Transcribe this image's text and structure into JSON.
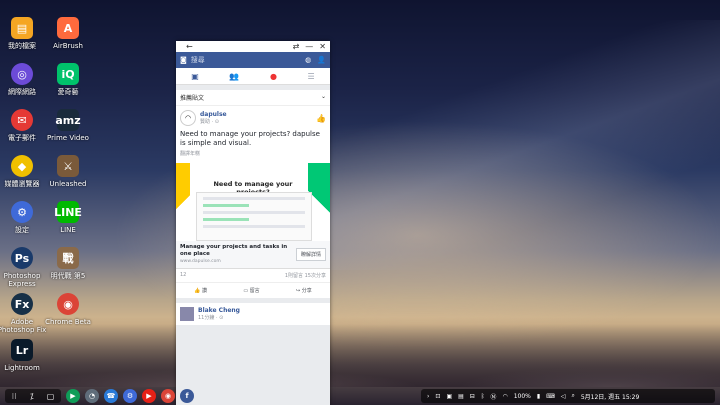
{
  "desktop_icons": [
    {
      "label": "我的檔案",
      "glyph": "▤",
      "color": "#f5a623",
      "shape": "sq"
    },
    {
      "label": "AirBrush",
      "glyph": "A",
      "color": "#ff6a3d",
      "shape": "sq"
    },
    {
      "label": "網際網路",
      "glyph": "◎",
      "color": "#6c4bd8",
      "shape": "round"
    },
    {
      "label": "愛奇藝",
      "glyph": "iQ",
      "color": "#00c26b",
      "shape": "sq"
    },
    {
      "label": "電子郵件",
      "glyph": "✉",
      "color": "#e53935",
      "shape": "round"
    },
    {
      "label": "Prime Video",
      "glyph": "amz",
      "color": "#1a2b3c",
      "shape": "sq"
    },
    {
      "label": "媒體瀏覽器",
      "glyph": "◆",
      "color": "#f0c000",
      "shape": "round"
    },
    {
      "label": "Unleashed",
      "glyph": "⚔",
      "color": "#7a5a3a",
      "shape": "sq"
    },
    {
      "label": "設定",
      "glyph": "⚙",
      "color": "#3f6ad8",
      "shape": "round"
    },
    {
      "label": "LINE",
      "glyph": "LINE",
      "color": "#00b900",
      "shape": "sq"
    },
    {
      "label": "Photoshop Express",
      "glyph": "Ps",
      "color": "#1a3a6a",
      "shape": "round"
    },
    {
      "label": "明代戰 第5",
      "glyph": "戰",
      "color": "#8a6a4a",
      "shape": "sq"
    },
    {
      "label": "Adobe Photoshop Fix",
      "glyph": "Fx",
      "color": "#173047",
      "shape": "round"
    },
    {
      "label": "Chrome Beta",
      "glyph": "◉",
      "color": "#db4437",
      "shape": "round"
    },
    {
      "label": "Lightroom",
      "glyph": "Lr",
      "color": "#0a1a2a",
      "shape": "sq"
    }
  ],
  "window": {
    "search_placeholder": "搜尋",
    "section_label": "推薦貼文",
    "post": {
      "author": "dapulse",
      "subtitle": "贊助 · ⊙",
      "text": "Need to manage your projects? dapulse is simple and visual.",
      "translate": "翻譯年糕",
      "ad_headline": "Need to manage your projects?",
      "link_title": "Manage your projects and tasks in one place",
      "link_url": "www.dapulse.com",
      "cta": "瞭解詳情",
      "reactions": "12",
      "comments_shares": "1則留言 15次分享",
      "like": "讚",
      "comment": "留言",
      "share": "分享"
    },
    "post2": {
      "author": "Blake Cheng",
      "subtitle": "11分鐘 · ⊙"
    }
  },
  "taskbar": {
    "apps": [
      {
        "glyph": "▶",
        "color": "#0f9d58"
      },
      {
        "glyph": "◔",
        "color": "#5f6d7a"
      },
      {
        "glyph": "☎",
        "color": "#2a7ad8"
      },
      {
        "glyph": "⚙",
        "color": "#3f6ad8"
      },
      {
        "glyph": "▶",
        "color": "#e62117"
      },
      {
        "glyph": "◉",
        "color": "#db4437"
      },
      {
        "glyph": "f",
        "color": "#3b5998"
      }
    ],
    "battery": "100%",
    "clock": "5月12日, 週五  15:29"
  }
}
